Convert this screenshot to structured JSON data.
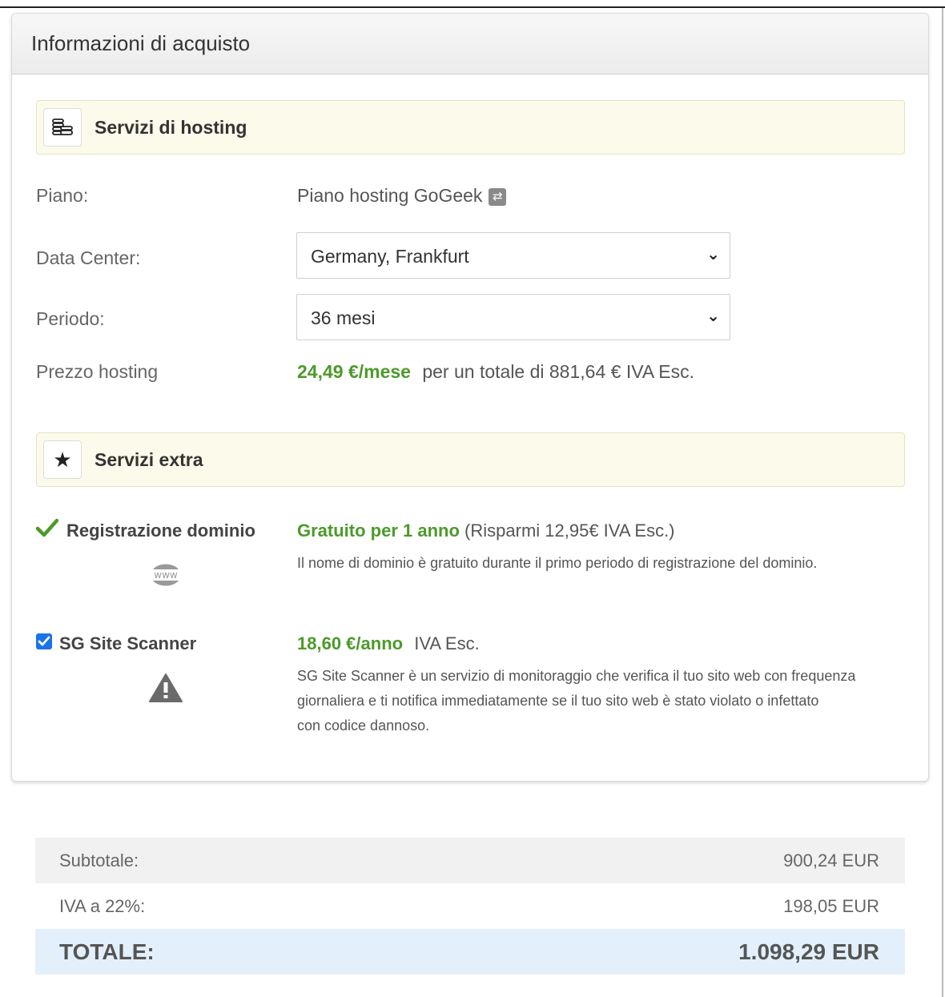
{
  "panel": {
    "title": "Informazioni di acquisto"
  },
  "hosting_section": {
    "title": "Servizi di hosting",
    "icon": "coins-icon",
    "plan_label": "Piano:",
    "plan_value": "Piano hosting GoGeek",
    "datacenter_label": "Data Center:",
    "datacenter_value": "Germany, Frankfurt",
    "period_label": "Periodo:",
    "period_value": "36 mesi",
    "price_label": "Prezzo hosting",
    "price_monthly": "24,49 €/mese",
    "price_total": "per un totale di 881,64 € IVA Esc."
  },
  "extra_section": {
    "title": "Servizi extra",
    "icon": "star-icon",
    "domain": {
      "label": "Registrazione dominio",
      "icon_text": "www",
      "offer": "Gratuito per 1 anno",
      "saving": "(Risparmi 12,95€ IVA Esc.)",
      "description": "Il nome di dominio è gratuito durante il primo periodo di registrazione del dominio."
    },
    "scanner": {
      "label": "SG Site Scanner",
      "checked": true,
      "price": "18,60 €/anno",
      "vat": "IVA Esc.",
      "description_line1": "SG Site Scanner è un servizio di monitoraggio che verifica il tuo sito web con frequenza",
      "description_line2": "giornaliera e ti notifica immediatamente se il tuo sito web è stato violato o infettato",
      "description_line3": "con codice dannoso."
    }
  },
  "summary": {
    "subtotal_label": "Subtotale:",
    "subtotal_value": "900,24 EUR",
    "vat_label": "IVA a 22%:",
    "vat_value": "198,05 EUR",
    "total_label": "TOTALE:",
    "total_value": "1.098,29 EUR"
  },
  "colors": {
    "accent_green": "#4c9a2a",
    "section_bg": "#fcfaea",
    "total_bg": "#e3f0fb",
    "subtotal_bg": "#f1f1f1"
  }
}
